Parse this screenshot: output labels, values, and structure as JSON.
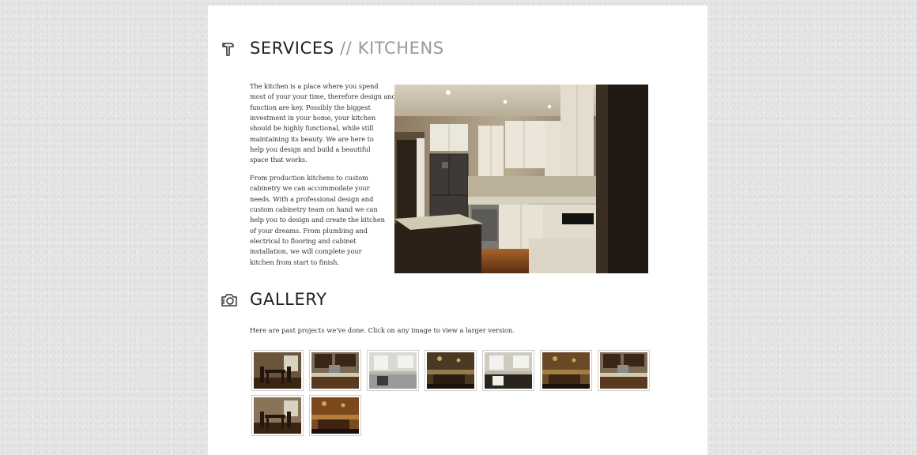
{
  "services": {
    "title_main": "SERVICES",
    "title_sep": " // ",
    "title_sub": "KITCHENS",
    "icon": "hammer-icon",
    "paragraph1_lines": [
      "The kitchen is a place where you spend",
      "most of your your time, therefore design and",
      "function are key.  Possibly the biggest",
      "investment in your home, your kitchen",
      "should be highly functional, while still",
      "maintaining its beauty.  We are here to",
      "help you design and build a beautiful",
      "space that works."
    ],
    "paragraph2_lines": [
      "From production kitchens to custom",
      "cabinetry we can accommodate your",
      "needs.  With a professional design and",
      "custom cabinetry team on hand we can",
      "help you to design and create the kitchen",
      "of your dreams.  From plumbing and",
      "electrical to flooring and cabinet",
      "installation, we will complete your",
      "kitchen from start to finish."
    ],
    "photo": "kitchen-photo"
  },
  "gallery": {
    "title": "GALLERY",
    "icon": "camera-icon",
    "intro": "Here are past projects we've done. Click on any image to view a larger version.",
    "thumbnails": [
      {
        "name": "gallery-thumb-1",
        "scene": "dining",
        "wall": "#6b5439",
        "floor": "#3a2412",
        "accent": "#1f1611"
      },
      {
        "name": "gallery-thumb-2",
        "scene": "cabinets",
        "wall": "#7a6a55",
        "floor": "#5a3a1e",
        "accent": "#3a2616"
      },
      {
        "name": "gallery-thumb-3",
        "scene": "white",
        "wall": "#d8d8d4",
        "floor": "#9a9a98",
        "accent": "#3a3a3a"
      },
      {
        "name": "gallery-thumb-4",
        "scene": "dark",
        "wall": "#4a3a22",
        "floor": "#2a1d10",
        "accent": "#c7a56a"
      },
      {
        "name": "gallery-thumb-5",
        "scene": "white",
        "wall": "#cfcac0",
        "floor": "#2a241e",
        "accent": "#efeee9"
      },
      {
        "name": "gallery-thumb-6",
        "scene": "dark",
        "wall": "#6a4a26",
        "floor": "#3a2612",
        "accent": "#caa05a"
      },
      {
        "name": "gallery-thumb-7",
        "scene": "cabinets",
        "wall": "#7d6a52",
        "floor": "#5a3a1e",
        "accent": "#3a2616"
      },
      {
        "name": "gallery-thumb-8",
        "scene": "dining",
        "wall": "#8a7458",
        "floor": "#3a2412",
        "accent": "#24170f"
      },
      {
        "name": "gallery-thumb-9",
        "scene": "dark",
        "wall": "#7a4a1e",
        "floor": "#3e2310",
        "accent": "#e0a052"
      }
    ]
  },
  "colors": {
    "page_bg": "#ffffff",
    "body_bg": "#e6e6e6",
    "heading": "#222222",
    "heading_sep": "#9a9a9a",
    "text": "#333333"
  }
}
